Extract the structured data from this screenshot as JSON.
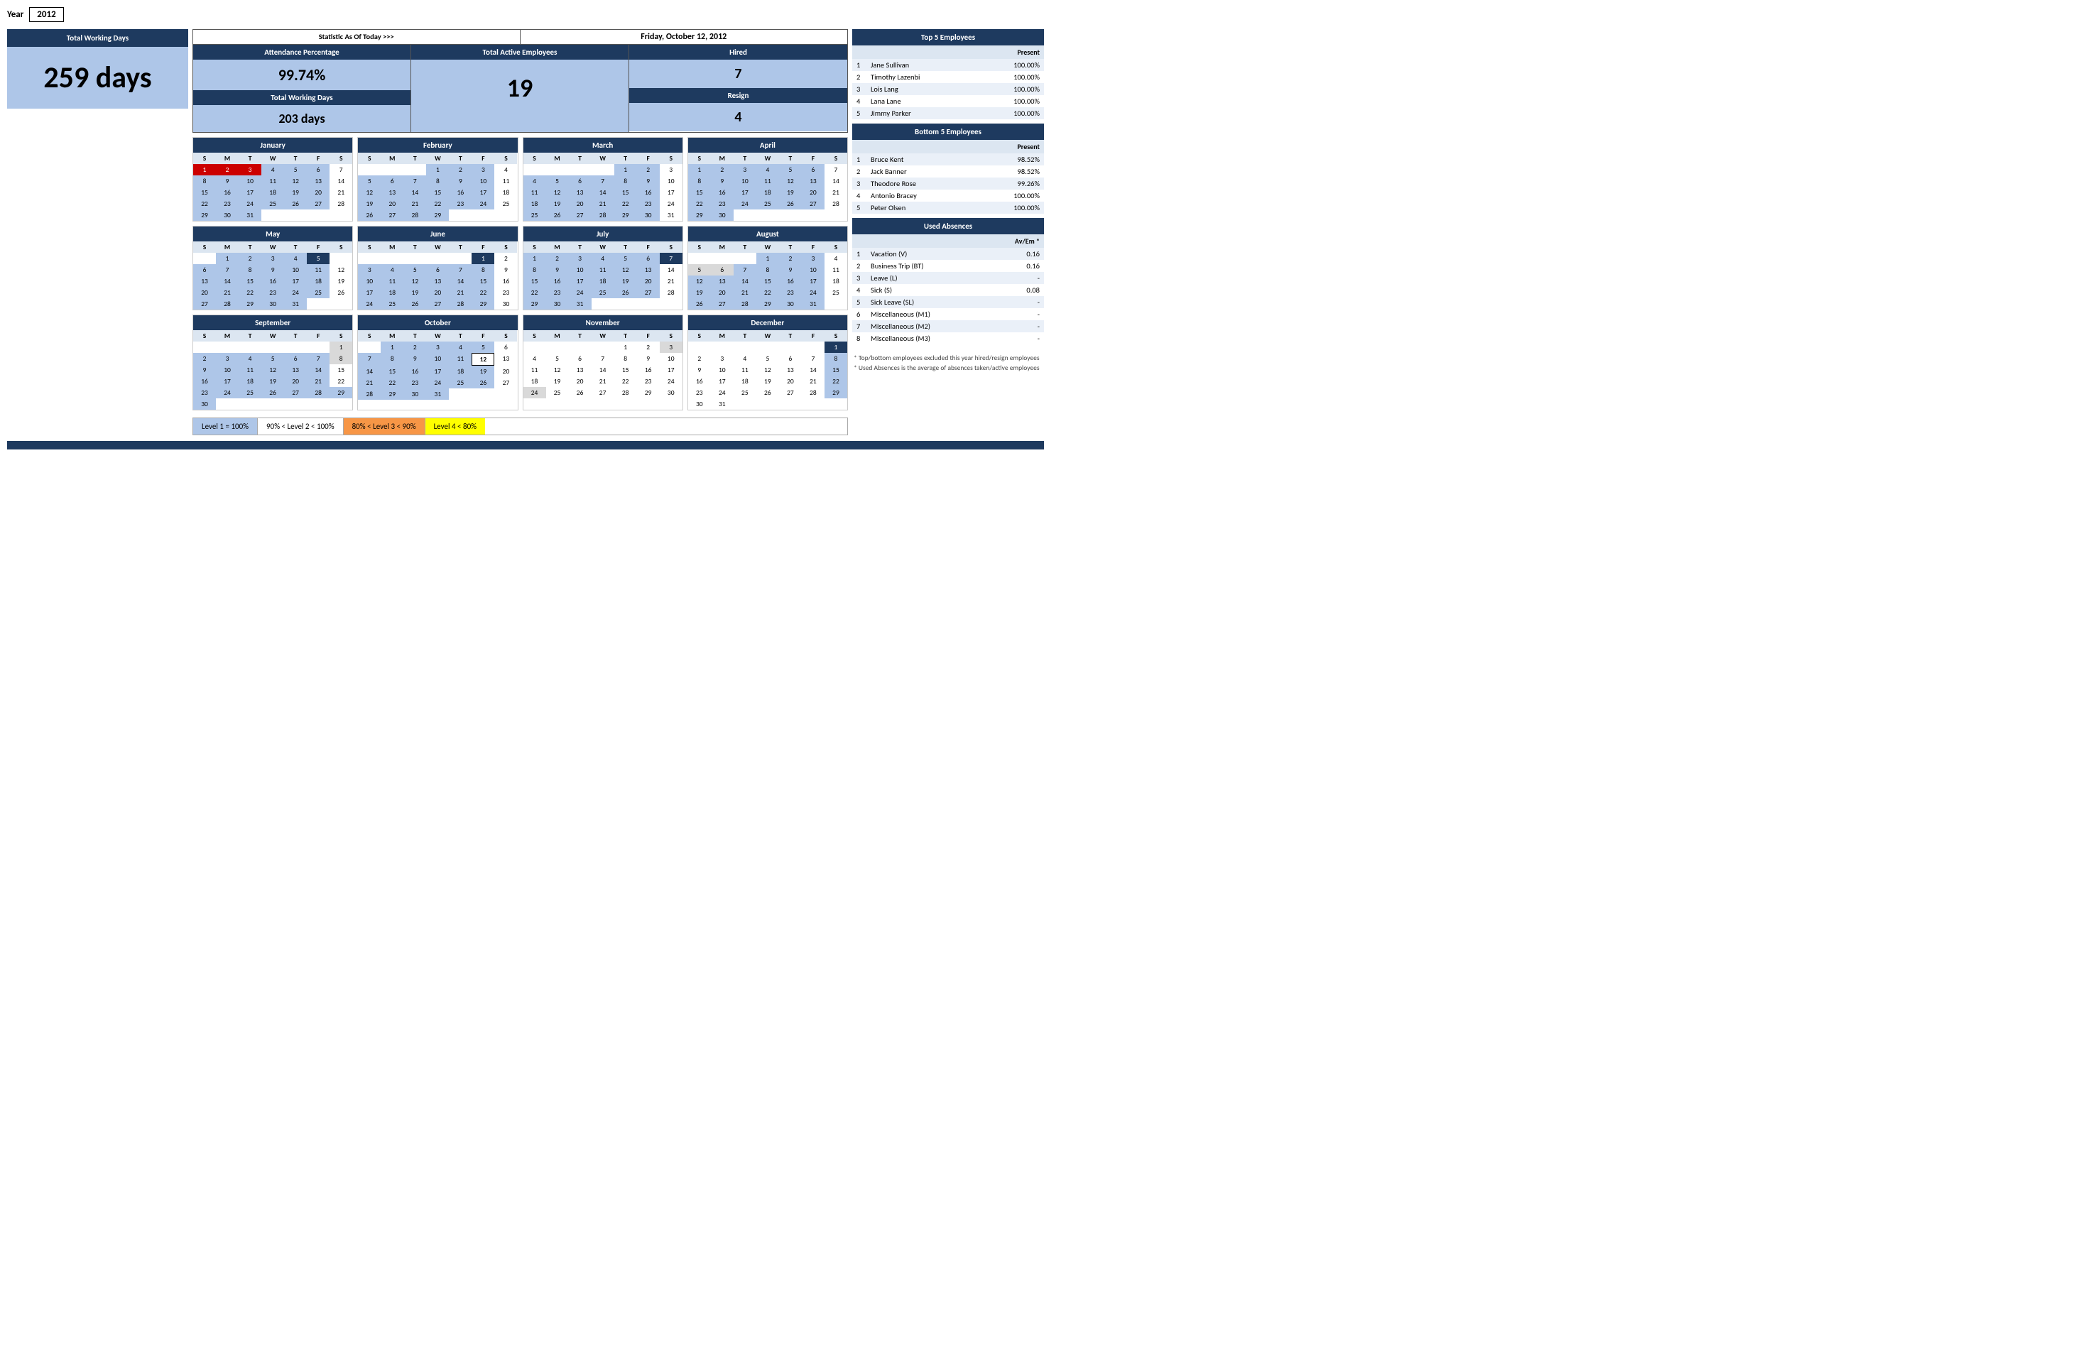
{
  "year": {
    "label": "Year",
    "value": "2012"
  },
  "totalWorkingDays": {
    "label": "Total Working Days",
    "value": "259 days"
  },
  "stats": {
    "title": "Statistic As Of Today   >>>",
    "date": "Friday, October 12, 2012",
    "attendanceLabel": "Attendance Percentage",
    "attendanceValue": "99.74%",
    "totalWorkingLabel": "Total Working Days",
    "totalWorkingValue": "203 days",
    "totalActiveLabel": "Total Active Employees",
    "totalActiveValue": "19",
    "hiredLabel": "Hired",
    "hiredValue": "7",
    "resignLabel": "Resign",
    "resignValue": "4"
  },
  "calendars": [
    {
      "name": "January",
      "days": [
        "",
        "",
        "",
        "",
        "",
        "",
        "1",
        "",
        "",
        "",
        "",
        "",
        "",
        "",
        "",
        "",
        "",
        "",
        "",
        "",
        "",
        "",
        "",
        "",
        "",
        "",
        "",
        "",
        "",
        "",
        "",
        "",
        "",
        "",
        "",
        "",
        "",
        "",
        "",
        "",
        ""
      ],
      "weeks": [
        [
          "",
          "",
          "",
          "",
          "5",
          "6",
          "7"
        ],
        [
          "8",
          "9",
          "10",
          "11",
          "12",
          "13",
          "14"
        ],
        [
          "15",
          "16",
          "17",
          "18",
          "19",
          "20",
          "21"
        ],
        [
          "22",
          "23",
          "24",
          "25",
          "26",
          "27",
          "28"
        ],
        [
          "29",
          "30",
          "31",
          "",
          "",
          "",
          ""
        ]
      ],
      "firstWeek": [
        "1",
        "2",
        "3",
        "4",
        "5",
        "6",
        "7"
      ],
      "highlights": [
        "1",
        "2",
        "3",
        "8",
        "9",
        "10",
        "11",
        "12",
        "13",
        "14",
        "15",
        "16",
        "17",
        "18",
        "19",
        "20",
        "21",
        "22",
        "23",
        "24",
        "25",
        "26",
        "27",
        "28"
      ],
      "redDays": [
        "1",
        "2",
        "3"
      ],
      "startDay": 0
    }
  ],
  "top5": {
    "header": "Top 5 Employees",
    "presentLabel": "Present",
    "employees": [
      {
        "rank": "1",
        "name": "Jane Sullivan",
        "present": "100.00%"
      },
      {
        "rank": "2",
        "name": "Timothy Lazenbi",
        "present": "100.00%"
      },
      {
        "rank": "3",
        "name": "Lois Lang",
        "present": "100.00%"
      },
      {
        "rank": "4",
        "name": "Lana Lane",
        "present": "100.00%"
      },
      {
        "rank": "5",
        "name": "Jimmy Parker",
        "present": "100.00%"
      }
    ]
  },
  "bottom5": {
    "header": "Bottom 5 Employees",
    "presentLabel": "Present",
    "employees": [
      {
        "rank": "1",
        "name": "Bruce Kent",
        "present": "98.52%"
      },
      {
        "rank": "2",
        "name": "Jack Banner",
        "present": "98.52%"
      },
      {
        "rank": "3",
        "name": "Theodore Rose",
        "present": "99.26%"
      },
      {
        "rank": "4",
        "name": "Antonio Bracey",
        "present": "100.00%"
      },
      {
        "rank": "5",
        "name": "Peter Olsen",
        "present": "100.00%"
      }
    ]
  },
  "usedAbsences": {
    "header": "Used Absences",
    "avEmLabel": "Av/Em *",
    "items": [
      {
        "rank": "1",
        "name": "Vacation (V)",
        "value": "0.16"
      },
      {
        "rank": "2",
        "name": "Business Trip (BT)",
        "value": "0.16"
      },
      {
        "rank": "3",
        "name": "Leave (L)",
        "value": "-"
      },
      {
        "rank": "4",
        "name": "Sick (S)",
        "value": "0.08"
      },
      {
        "rank": "5",
        "name": "Sick Leave (SL)",
        "value": "-"
      },
      {
        "rank": "6",
        "name": "Miscellaneous (M1)",
        "value": "-"
      },
      {
        "rank": "7",
        "name": "Miscellaneous (M2)",
        "value": "-"
      },
      {
        "rank": "8",
        "name": "Miscellaneous (M3)",
        "value": "-"
      }
    ]
  },
  "notes": {
    "line1": "* Top/bottom employees excluded this year hired/resign employees",
    "line2": "* Used Absences is the average of absences taken/active employees"
  },
  "legend": {
    "l1label": "Level 1",
    "l1eq": "=",
    "l1val": "100%",
    "l2min": "90%",
    "l2lt": "<",
    "l2label": "Level 2",
    "l2lt2": "<",
    "l2max": "100%",
    "l3min": "80%",
    "l3lt": "<",
    "l3label": "Level 3",
    "l3lt2": "<",
    "l3max": "90%",
    "l4label": "Level 4",
    "l4lt": "<",
    "l4val": "80%"
  }
}
